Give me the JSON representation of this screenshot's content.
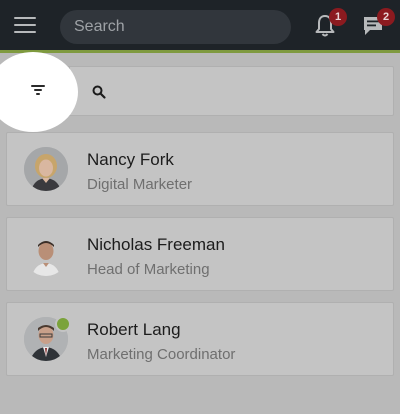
{
  "header": {
    "menu_icon": "hamburger-menu-icon",
    "search_placeholder": "Search",
    "notifications": {
      "icon": "bell-icon",
      "count": "1"
    },
    "messages": {
      "icon": "chat-bubble-icon",
      "count": "2"
    }
  },
  "filter_bar": {
    "filter_icon": "filter-icon",
    "search_icon": "search-icon",
    "input_value": ""
  },
  "contacts": [
    {
      "name": "Nancy Fork",
      "title": "Digital Marketer",
      "online": false
    },
    {
      "name": "Nicholas Freeman",
      "title": "Head of Marketing",
      "online": false
    },
    {
      "name": "Robert Lang",
      "title": "Marketing Coordinator",
      "online": true
    }
  ],
  "colors": {
    "topbar": "#1e2328",
    "accent": "#7f9a3f",
    "badge": "#8b1a1f",
    "online": "#7ba33b",
    "overlay": "#b9b9b9"
  }
}
